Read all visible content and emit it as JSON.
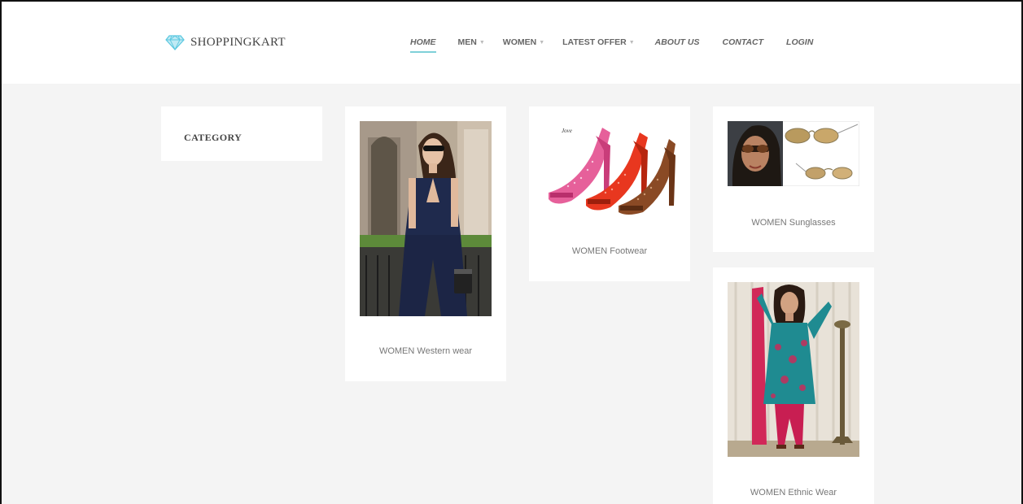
{
  "brand": {
    "name": "SHOPPINGKART",
    "icon": "diamond-icon",
    "icon_color": "#5bc8e0"
  },
  "nav": {
    "home": "HOME",
    "men": "MEN",
    "women": "WOMEN",
    "latest_offer": "LATEST OFFER",
    "about_us": "ABOUT US",
    "contact": "CONTACT",
    "login": "LOGIN",
    "active_underline_color": "#7fd0d8"
  },
  "sidebar": {
    "title": "CATEGORY"
  },
  "products": [
    {
      "caption": "WOMEN Western wear"
    },
    {
      "caption": "WOMEN Footwear",
      "image_text": "Jove"
    },
    {
      "caption": "WOMEN Sunglasses"
    },
    {
      "caption": "WOMEN Ethnic Wear"
    }
  ]
}
